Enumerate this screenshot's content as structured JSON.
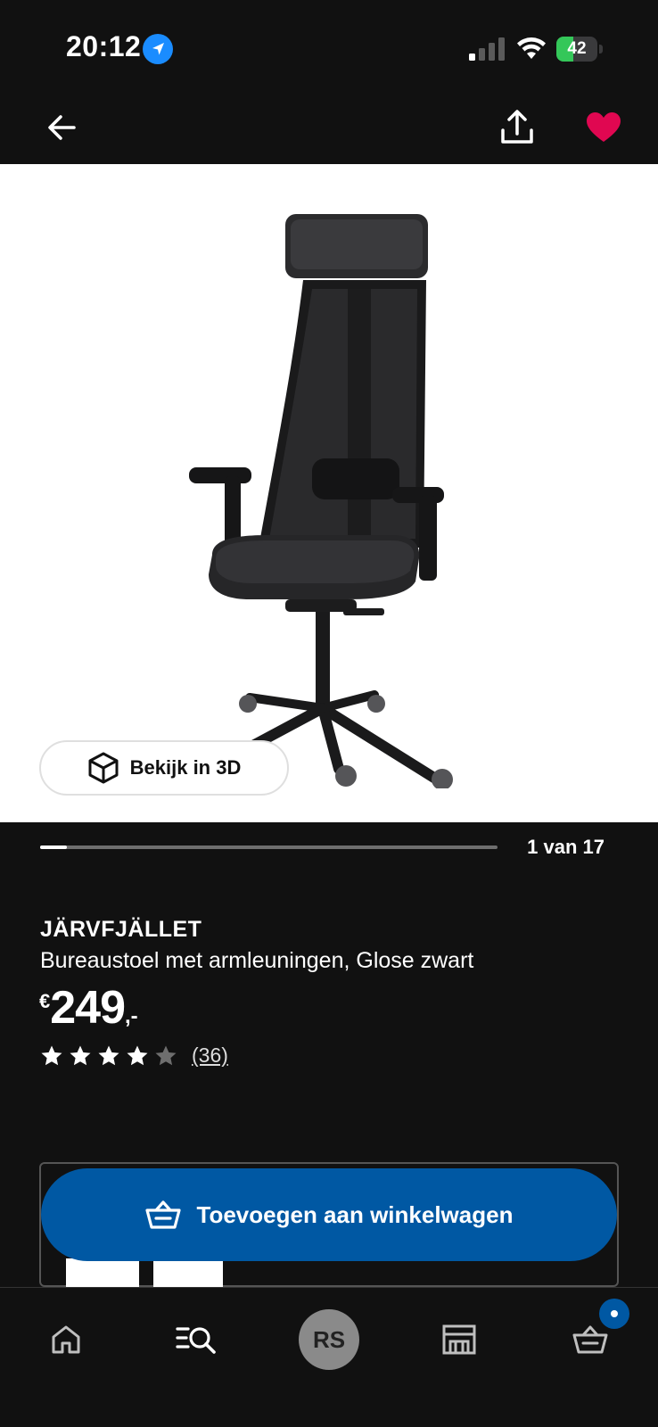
{
  "status_bar": {
    "time": "20:12",
    "battery": "42",
    "battery_level": 0.42,
    "icons": [
      "location-arrow-icon",
      "cellular-signal-icon",
      "wifi-icon",
      "battery-charging-icon"
    ]
  },
  "nav": {
    "icons": [
      "arrow-left-icon",
      "share-icon",
      "heart-icon"
    ],
    "favorite_color": "#e00751"
  },
  "gallery": {
    "view_3d_label": "Bekijk in 3D",
    "counter": "1 van 17",
    "progress_fraction": 0.0588
  },
  "product": {
    "name": "JÄRVFJÄLLET",
    "description": "Bureaustoel met armleuningen, Glose zwart",
    "price_currency": "€",
    "price_main": "249",
    "price_suffix": ",-",
    "rating": 4,
    "rating_max": 5,
    "review_count": "(36)"
  },
  "cart_button": {
    "label": "Toevoegen aan winkelwagen",
    "color": "#0058a3"
  },
  "tab_bar": {
    "avatar_initials": "RS",
    "icons": [
      "home-icon",
      "search-list-icon",
      "avatar",
      "store-icon",
      "basket-icon"
    ],
    "badge_color": "#0058a3"
  }
}
